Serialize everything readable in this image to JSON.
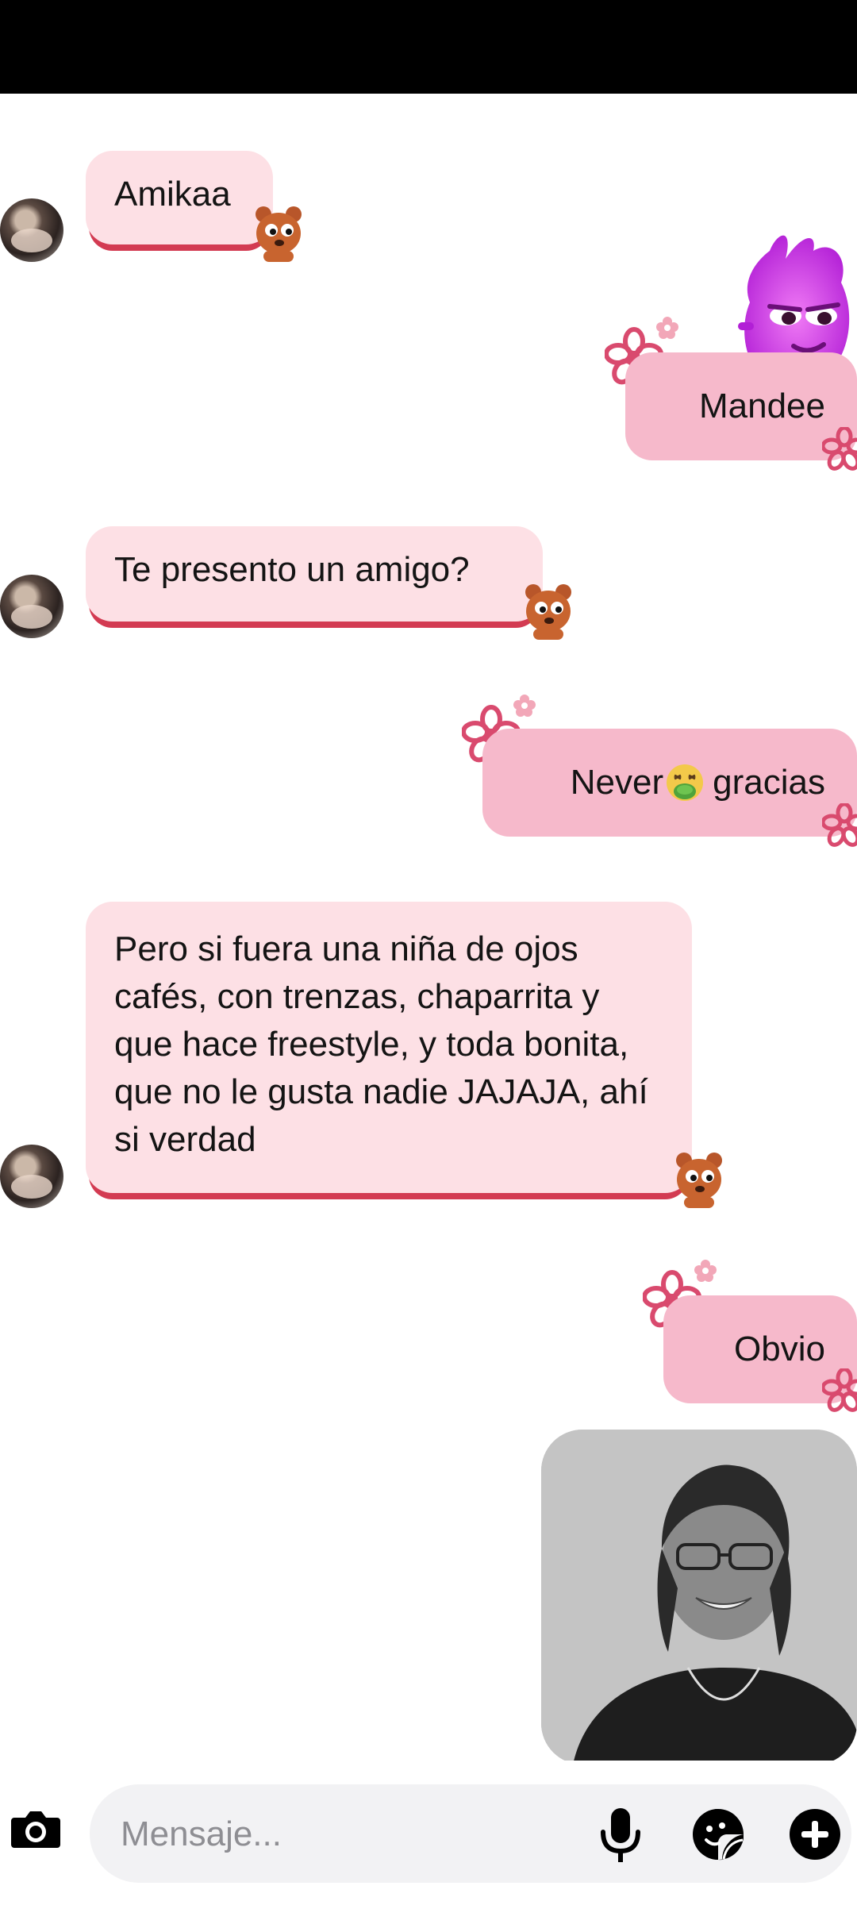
{
  "status_bar": {},
  "messages": [
    {
      "direction": "incoming",
      "text": "Amikaa"
    },
    {
      "direction": "outgoing",
      "text": "Mandee"
    },
    {
      "direction": "incoming",
      "text": "Te presento un amigo?"
    },
    {
      "direction": "outgoing",
      "text_before": "Never",
      "emoji": "nauseated-face",
      "text_after": "gracias"
    },
    {
      "direction": "incoming",
      "text": "Pero si fuera una niña de ojos cafés, con trenzas, chaparrita y que hace freestyle, y toda bonita, que no le gusta nadie JAJAJA, ahí si verdad"
    },
    {
      "direction": "outgoing",
      "text": "Obvio"
    },
    {
      "direction": "outgoing",
      "type": "photo",
      "content": "grayscale photo of a smiling person"
    }
  ],
  "composer": {
    "placeholder": "Mensaje...",
    "icons": [
      "camera-icon",
      "microphone-icon",
      "sticker-icon",
      "plus-icon"
    ]
  },
  "colors": {
    "incoming_bubble": "#fde0e5",
    "incoming_underline": "#d33b52",
    "outgoing_bubble": "#f6b9cb",
    "flower": "#d94a6e"
  }
}
